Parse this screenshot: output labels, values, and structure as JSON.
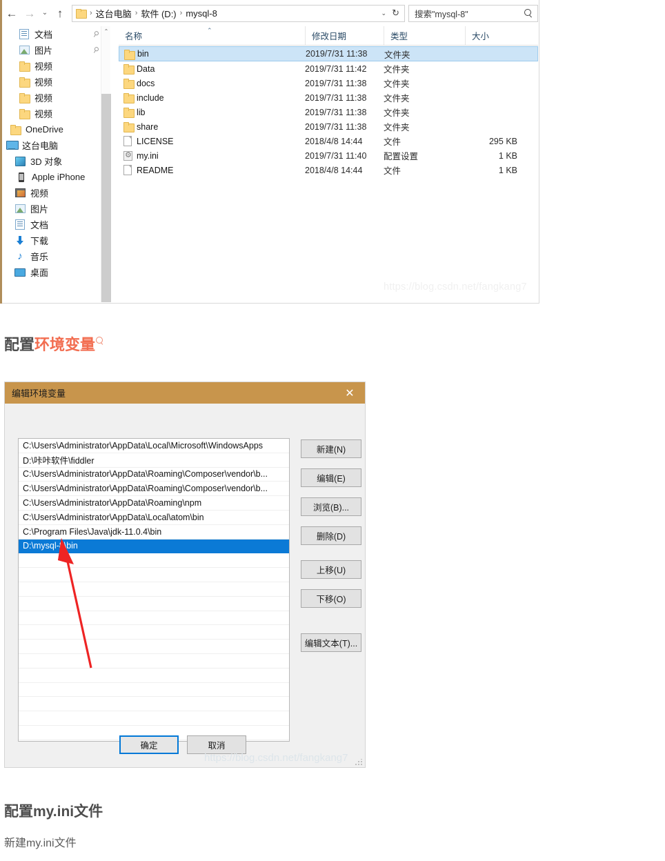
{
  "explorer": {
    "nav": {
      "back": "back-arrow",
      "forward": "forward-arrow",
      "recent": "chevron-down",
      "up": "up-arrow"
    },
    "address": {
      "crumbs": [
        "这台电脑",
        "软件 (D:)",
        "mysql-8"
      ],
      "separator": "›",
      "dropdown": "⌄",
      "refresh": "↻"
    },
    "search": {
      "placeholder": "搜索\"mysql-8\""
    },
    "sidebar": [
      {
        "label": "文档",
        "icon": "document-icon",
        "indent": 22,
        "pinned": true
      },
      {
        "label": "图片",
        "icon": "picture-icon",
        "indent": 22,
        "pinned": true
      },
      {
        "label": "视频",
        "icon": "folder-icon",
        "indent": 22,
        "pinned": false
      },
      {
        "label": "视频",
        "icon": "folder-icon",
        "indent": 22,
        "pinned": false
      },
      {
        "label": "视频",
        "icon": "folder-icon",
        "indent": 22,
        "pinned": false
      },
      {
        "label": "视频",
        "icon": "folder-icon",
        "indent": 22,
        "pinned": false
      },
      {
        "label": "OneDrive",
        "icon": "folder-icon",
        "indent": 9,
        "pinned": false
      },
      {
        "label": "这台电脑",
        "icon": "computer-icon",
        "indent": 4,
        "pinned": false
      },
      {
        "label": "3D 对象",
        "icon": "cube-3d-icon",
        "indent": 16,
        "pinned": false
      },
      {
        "label": "Apple iPhone",
        "icon": "phone-icon",
        "indent": 18,
        "pinned": false
      },
      {
        "label": "视频",
        "icon": "video-icon",
        "indent": 16,
        "pinned": false
      },
      {
        "label": "图片",
        "icon": "picture-icon",
        "indent": 16,
        "pinned": false
      },
      {
        "label": "文档",
        "icon": "document-icon",
        "indent": 16,
        "pinned": false
      },
      {
        "label": "下载",
        "icon": "download-icon",
        "indent": 16,
        "pinned": false
      },
      {
        "label": "音乐",
        "icon": "music-icon",
        "indent": 16,
        "pinned": false
      },
      {
        "label": "桌面",
        "icon": "desktop-icon",
        "indent": 16,
        "pinned": false
      }
    ],
    "columns": {
      "name": "名称",
      "date": "修改日期",
      "type": "类型",
      "size": "大小",
      "sort_arrow": "⌃"
    },
    "files": [
      {
        "name": "bin",
        "date": "2019/7/31 11:38",
        "type": "文件夹",
        "size": "",
        "icon": "folder-icon",
        "selected": true
      },
      {
        "name": "Data",
        "date": "2019/7/31 11:42",
        "type": "文件夹",
        "size": "",
        "icon": "folder-icon",
        "selected": false
      },
      {
        "name": "docs",
        "date": "2019/7/31 11:38",
        "type": "文件夹",
        "size": "",
        "icon": "folder-icon",
        "selected": false
      },
      {
        "name": "include",
        "date": "2019/7/31 11:38",
        "type": "文件夹",
        "size": "",
        "icon": "folder-icon",
        "selected": false
      },
      {
        "name": "lib",
        "date": "2019/7/31 11:38",
        "type": "文件夹",
        "size": "",
        "icon": "folder-icon",
        "selected": false
      },
      {
        "name": "share",
        "date": "2019/7/31 11:38",
        "type": "文件夹",
        "size": "",
        "icon": "folder-icon",
        "selected": false
      },
      {
        "name": "LICENSE",
        "date": "2018/4/8 14:44",
        "type": "文件",
        "size": "295 KB",
        "icon": "file-icon",
        "selected": false
      },
      {
        "name": "my.ini",
        "date": "2019/7/31 11:40",
        "type": "配置设置",
        "size": "1 KB",
        "icon": "ini-file-icon",
        "selected": false
      },
      {
        "name": "README",
        "date": "2018/4/8 14:44",
        "type": "文件",
        "size": "1 KB",
        "icon": "file-icon",
        "selected": false
      }
    ],
    "watermark": "https://blog.csdn.net/fangkang7"
  },
  "heading_env": {
    "prefix": "配置",
    "accent": "环境变量"
  },
  "dialog": {
    "title": "编辑环境变量",
    "close": "✕",
    "paths": [
      {
        "value": "C:\\Users\\Administrator\\AppData\\Local\\Microsoft\\WindowsApps",
        "selected": false
      },
      {
        "value": "D:\\咔咔软件\\fiddler",
        "selected": false
      },
      {
        "value": "C:\\Users\\Administrator\\AppData\\Roaming\\Composer\\vendor\\b...",
        "selected": false
      },
      {
        "value": "C:\\Users\\Administrator\\AppData\\Roaming\\Composer\\vendor\\b...",
        "selected": false
      },
      {
        "value": "C:\\Users\\Administrator\\AppData\\Roaming\\npm",
        "selected": false
      },
      {
        "value": "C:\\Users\\Administrator\\AppData\\Local\\atom\\bin",
        "selected": false
      },
      {
        "value": "C:\\Program Files\\Java\\jdk-11.0.4\\bin",
        "selected": false
      },
      {
        "value": "D:\\mysql-8\\bin",
        "selected": true
      }
    ],
    "empty_rows": 13,
    "side_buttons": {
      "new": "新建(N)",
      "edit": "编辑(E)",
      "browse": "浏览(B)...",
      "delete": "删除(D)",
      "move_up": "上移(U)",
      "move_down": "下移(O)",
      "edit_text": "编辑文本(T)..."
    },
    "ok": "确定",
    "cancel": "取消",
    "watermark": "https://blog.csdn.net/fangkang7",
    "colors": {
      "title_bar": "#c8954c",
      "selected_row": "#0b7ad6",
      "focus_border": "#0078d7",
      "arrow": "#ee2424"
    }
  },
  "heading_myini": "配置my.ini文件",
  "text_newfile": "新建my.ini文件"
}
